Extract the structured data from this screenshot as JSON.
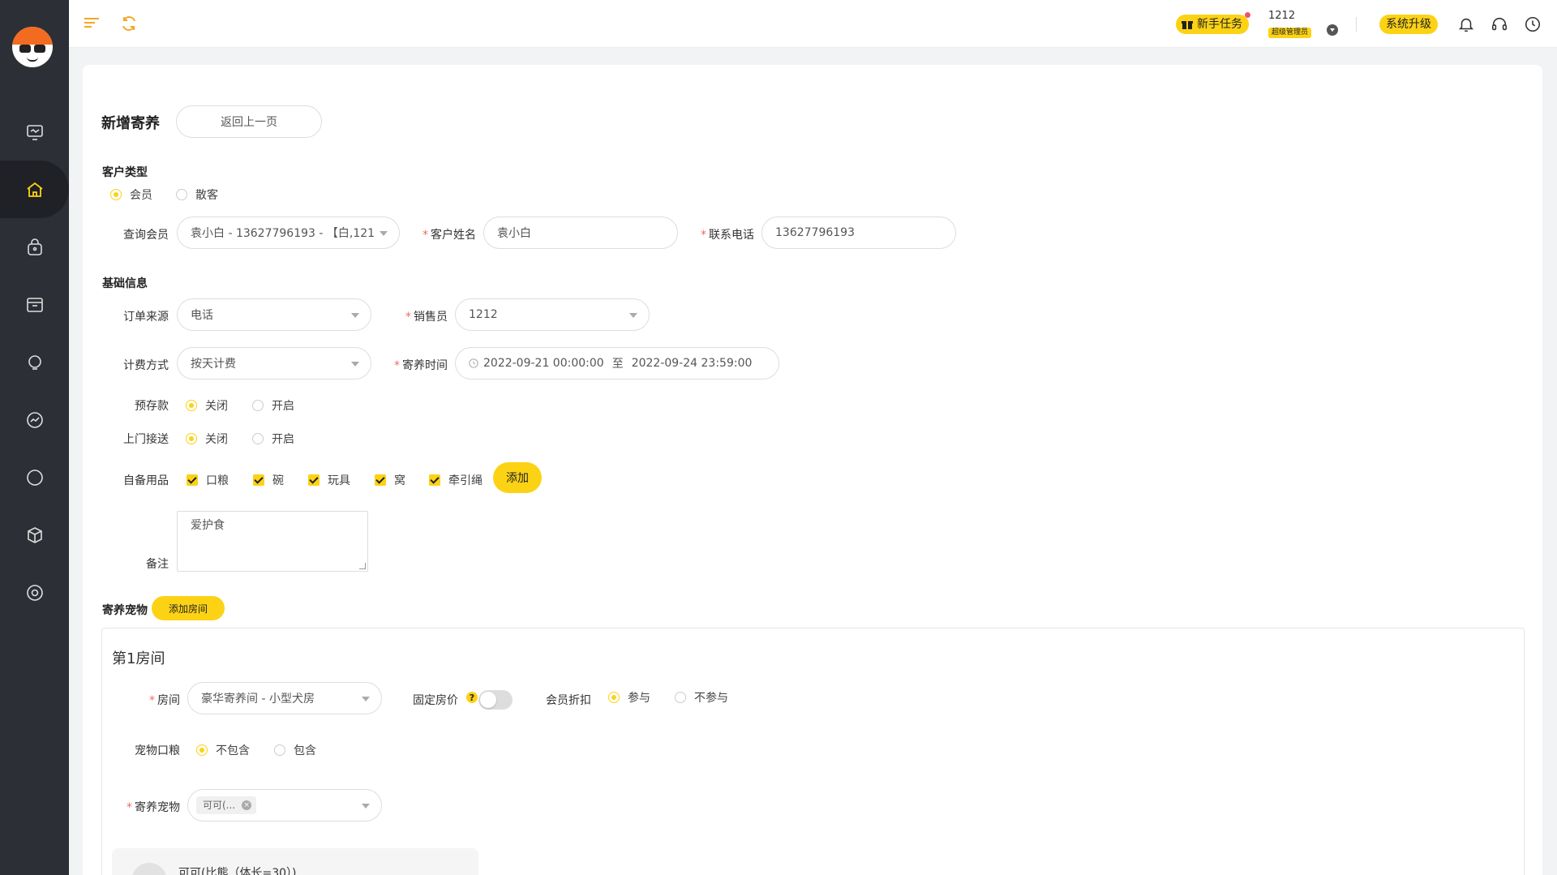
{
  "header": {
    "task_label": "新手任务",
    "user_name": "1212",
    "user_role": "超级管理员",
    "upgrade_label": "系统升级"
  },
  "page": {
    "title": "新增寄养",
    "back_label": "返回上一页"
  },
  "customer": {
    "section_title": "客户类型",
    "type_options": [
      "会员",
      "散客"
    ],
    "selected_type": "会员",
    "query_label": "查询会员",
    "query_value": "袁小白 - 13627796193 - 【白,121",
    "name_label": "客户姓名",
    "name_value": "袁小白",
    "phone_label": "联系电话",
    "phone_value": "13627796193"
  },
  "basic": {
    "section_title": "基础信息",
    "source_label": "订单来源",
    "source_value": "电话",
    "sales_label": "销售员",
    "sales_value": "1212",
    "billing_label": "计费方式",
    "billing_value": "按天计费",
    "period_label": "寄养时间",
    "period_start": "2022-09-21 00:00:00",
    "period_sep": "至",
    "period_end": "2022-09-24 23:59:00",
    "deposit_label": "预存款",
    "deposit_options": [
      "关闭",
      "开启"
    ],
    "pickup_label": "上门接送",
    "pickup_options": [
      "关闭",
      "开启"
    ],
    "supplies_label": "自备用品",
    "supplies": [
      "口粮",
      "碗",
      "玩具",
      "窝",
      "牵引绳"
    ],
    "add_label": "添加",
    "remark_label": "备注",
    "remark_value": "爱护食"
  },
  "pets": {
    "section_title": "寄养宠物",
    "add_room_label": "添加房间",
    "room_title": "第1房间",
    "room_label": "房间",
    "room_value": "豪华寄养间 - 小型犬房",
    "fixed_price_label": "固定房价",
    "help_glyph": "?",
    "discount_label": "会员折扣",
    "discount_options": [
      "参与",
      "不参与"
    ],
    "food_label": "宠物口粮",
    "food_options": [
      "不包含",
      "包含"
    ],
    "pet_label": "寄养宠物",
    "pet_tag": "可可(...",
    "pet_tag_close": "×",
    "pet_card_name": "可可(比熊（体长=30）)"
  },
  "colors": {
    "accent": "#fcd215",
    "sidebar": "#2c2f36",
    "required": "#f26b5b",
    "icon_orange": "#f4a623"
  }
}
